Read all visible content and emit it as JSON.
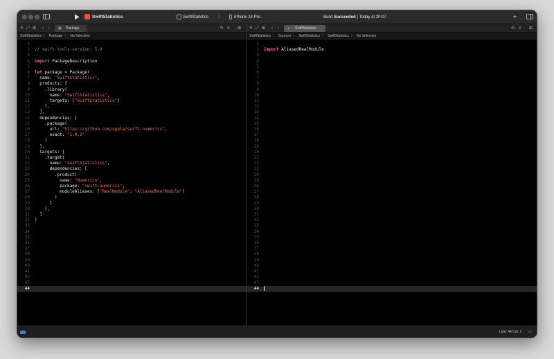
{
  "toolbar": {
    "project_name": "SwiftStatistics",
    "scheme": "SwiftStatistics",
    "scheme_sep": "〉",
    "destination": "iPhone 14 Pro",
    "status_prefix": "Build ",
    "status_bold": "Succeeded",
    "status_suffix": " | Today at 20:07",
    "add_icon": "+",
    "layout_icon": "⊡"
  },
  "left_pane": {
    "tab_label": "Package",
    "jumpbar": [
      "SwiftStatistics",
      "Package",
      "No Selection"
    ],
    "lines": [
      [],
      [
        {
          "c": "cmt",
          "t": "// swift-tools-version: 5.9"
        }
      ],
      [],
      [
        {
          "c": "kw",
          "t": "import"
        },
        {
          "c": "",
          "t": " PackageDescription"
        }
      ],
      [],
      [
        {
          "c": "kw",
          "t": "let"
        },
        {
          "c": "",
          "t": " package = Package("
        }
      ],
      [
        {
          "c": "",
          "t": "  name: "
        },
        {
          "c": "str",
          "t": "\"SwiftStatistics\""
        },
        {
          "c": "",
          "t": ","
        }
      ],
      [
        {
          "c": "",
          "t": "  products: ["
        }
      ],
      [
        {
          "c": "",
          "t": "    .library("
        }
      ],
      [
        {
          "c": "",
          "t": "      name: "
        },
        {
          "c": "str",
          "t": "\"SwiftStatistics\""
        },
        {
          "c": "",
          "t": ","
        }
      ],
      [
        {
          "c": "",
          "t": "      targets: ["
        },
        {
          "c": "str",
          "t": "\"SwiftStatistics\""
        },
        {
          "c": "",
          "t": "]"
        }
      ],
      [
        {
          "c": "",
          "t": "    ),"
        }
      ],
      [
        {
          "c": "",
          "t": "  ],"
        }
      ],
      [
        {
          "c": "",
          "t": "  dependencies: ["
        }
      ],
      [
        {
          "c": "",
          "t": "    .package("
        }
      ],
      [
        {
          "c": "",
          "t": "      url: "
        },
        {
          "c": "str",
          "t": "\"https://github.com/apple/swift-numerics\""
        },
        {
          "c": "",
          "t": ","
        }
      ],
      [
        {
          "c": "",
          "t": "      exact: "
        },
        {
          "c": "str",
          "t": "\"1.0.2\""
        }
      ],
      [
        {
          "c": "",
          "t": "    )"
        }
      ],
      [
        {
          "c": "",
          "t": "  ],"
        }
      ],
      [
        {
          "c": "",
          "t": "  targets: ["
        }
      ],
      [
        {
          "c": "",
          "t": "    .target("
        }
      ],
      [
        {
          "c": "",
          "t": "      name: "
        },
        {
          "c": "str",
          "t": "\"SwiftStatistics\""
        },
        {
          "c": "",
          "t": ","
        }
      ],
      [
        {
          "c": "",
          "t": "      dependencies: ["
        }
      ],
      [
        {
          "c": "",
          "t": "        .product("
        }
      ],
      [
        {
          "c": "",
          "t": "          name: "
        },
        {
          "c": "str",
          "t": "\"Numerics\""
        },
        {
          "c": "",
          "t": ","
        }
      ],
      [
        {
          "c": "",
          "t": "          package: "
        },
        {
          "c": "str",
          "t": "\"swift-numerics\""
        },
        {
          "c": "",
          "t": ","
        }
      ],
      [
        {
          "c": "",
          "t": "          moduleAliases: ["
        },
        {
          "c": "str",
          "t": "\"RealModule\""
        },
        {
          "c": "",
          "t": ": "
        },
        {
          "c": "str",
          "t": "\"AliasedRealModule\""
        },
        {
          "c": "",
          "t": "]"
        }
      ],
      [
        {
          "c": "",
          "t": "        )"
        }
      ],
      [
        {
          "c": "",
          "t": "      ]"
        }
      ],
      [
        {
          "c": "",
          "t": "    ),"
        }
      ],
      [
        {
          "c": "",
          "t": "  ]"
        }
      ],
      [
        {
          "c": "",
          "t": ")"
        }
      ]
    ]
  },
  "right_pane": {
    "tab_label": "SwiftStatistics",
    "jumpbar": [
      "SwiftStatistics",
      "Sources",
      "SwiftStatistics",
      "SwiftStatistics",
      "No Selection"
    ],
    "lines": [
      [],
      [
        {
          "c": "kw",
          "t": "import"
        },
        {
          "c": "",
          "t": " AliasedRealModule"
        }
      ]
    ]
  },
  "editor": {
    "total_lines": 44,
    "current_line": 44
  },
  "status_bar": {
    "position": "Line: 44  Col: 1"
  },
  "colors": {
    "keyword": "#fc5fa3",
    "string": "#fc6a5d",
    "comment": "#7f8c98",
    "accent": "#3f7ed8"
  },
  "icons": {
    "run": "play-icon",
    "scheme": "swift-package-icon",
    "destination": "iphone-icon",
    "sidebar": "sidebar-toggle-icon"
  }
}
